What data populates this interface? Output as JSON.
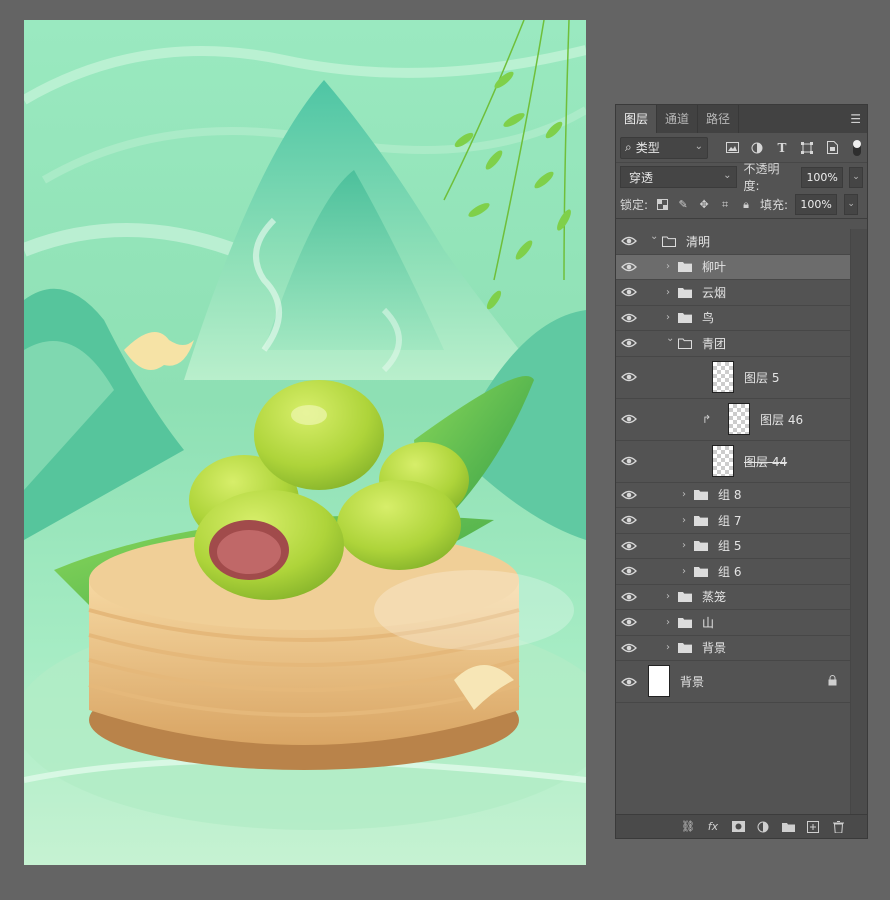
{
  "panel": {
    "tabs": [
      "图层",
      "通道",
      "路径"
    ],
    "active_tab": "图层",
    "filter": {
      "kind": "类型"
    },
    "blend_mode": "穿透",
    "opacity_label": "不透明度:",
    "opacity_value": "100%",
    "lock_label": "锁定:",
    "fill_label": "填充:",
    "fill_value": "100%",
    "menu_icon": "panel-menu-icon"
  },
  "layers": [
    {
      "name": "清明",
      "type": "group",
      "level": 0,
      "expanded": true
    },
    {
      "name": "柳叶",
      "type": "group",
      "level": 1,
      "expanded": false,
      "selected": true
    },
    {
      "name": "云烟",
      "type": "group",
      "level": 1,
      "expanded": false
    },
    {
      "name": "鸟",
      "type": "group",
      "level": 1,
      "expanded": false
    },
    {
      "name": "青团",
      "type": "group",
      "level": 1,
      "expanded": true
    },
    {
      "name": "图层 5",
      "type": "pixel",
      "level": 2
    },
    {
      "name": "图层 46",
      "type": "pixel",
      "level": 2,
      "clipped": true
    },
    {
      "name": "图层 44",
      "type": "pixel",
      "level": 2,
      "hidden_style": true
    },
    {
      "name": "组 8",
      "type": "group",
      "level": 2,
      "expanded": false
    },
    {
      "name": "组 7",
      "type": "group",
      "level": 2,
      "expanded": false
    },
    {
      "name": "组 5",
      "type": "group",
      "level": 2,
      "expanded": false
    },
    {
      "name": "组 6",
      "type": "group",
      "level": 2,
      "expanded": false
    },
    {
      "name": "蒸笼",
      "type": "group",
      "level": 1,
      "expanded": false
    },
    {
      "name": "山",
      "type": "group",
      "level": 1,
      "expanded": false
    },
    {
      "name": "背景",
      "type": "group",
      "level": 1,
      "expanded": false
    },
    {
      "name": "背景",
      "type": "background",
      "level": 0,
      "locked": true
    }
  ],
  "footer_icons": [
    "link-layers-icon",
    "fx-icon",
    "mask-icon",
    "adjustment-icon",
    "new-group-icon",
    "new-layer-icon",
    "trash-icon"
  ],
  "footer_fx_label": "fx",
  "colors": {
    "panel_bg": "#535353",
    "selected_row": "#6c6c6c",
    "canvas_bg": "#646464"
  }
}
